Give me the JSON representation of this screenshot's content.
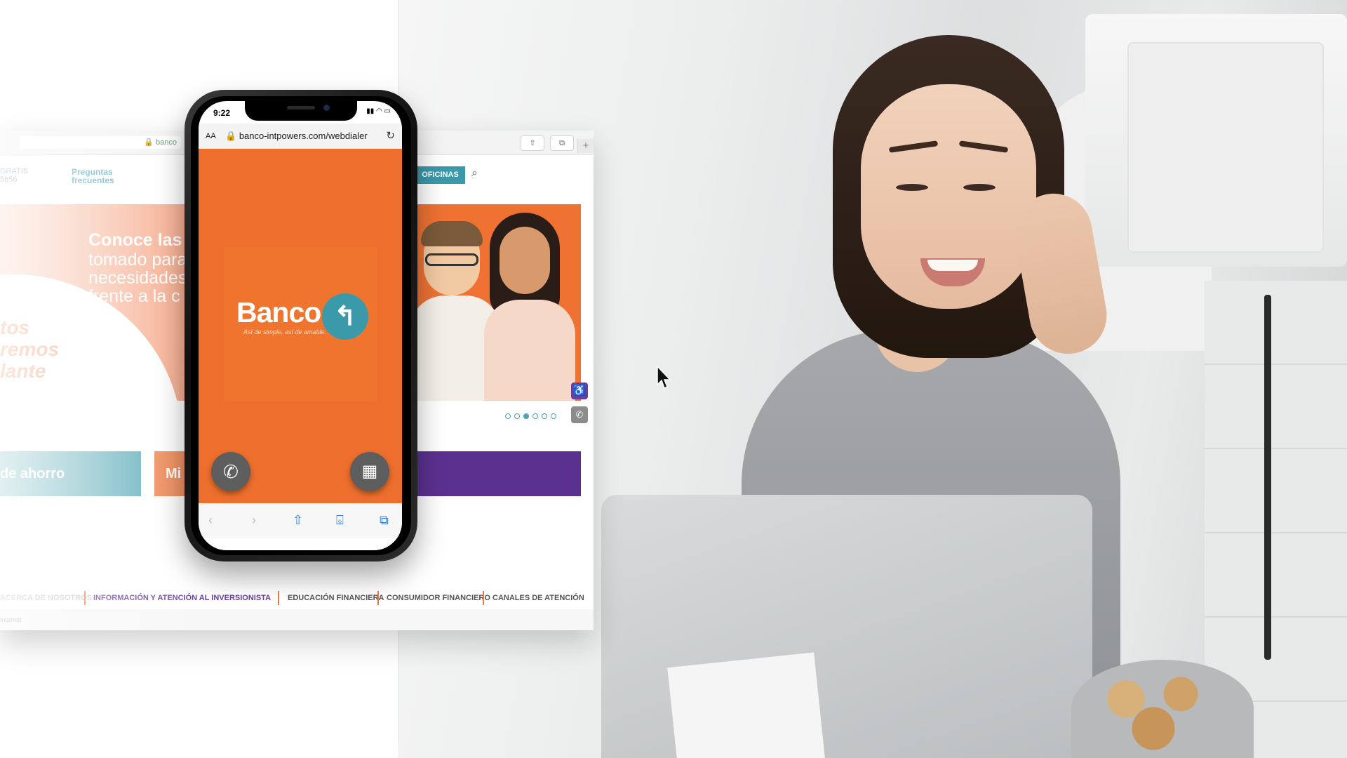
{
  "desktop": {
    "address_text": "banco",
    "nav_left_partial": "GRATIS\n5656",
    "nav_faq": "Preguntas\nfrecuentes",
    "oficinas_label": "OFICINAS",
    "hero": {
      "title": "Conoce las",
      "lines": "tomado para\nnecesidades\nfrente a la c",
      "italic_lines": "tos\nremos\nlante"
    },
    "cards": {
      "teal": "de ahorro",
      "orange": "Mi"
    },
    "carousel_dots": 6,
    "carousel_active": 3,
    "footer_nav": [
      "ACERCA DE NOSOTROS",
      "INFORMACIÓN Y ATENCIÓN AL INVERSIONISTA",
      "EDUCACIÓN FINANCIERA",
      "CONSUMIDOR FINANCIERO",
      "CANALES DE ATENCIÓN"
    ],
    "footer_small": "Internet"
  },
  "phone": {
    "time": "9:22",
    "status_icons": "▮▮ ◠ ▭",
    "aa_label": "AA",
    "url": "banco-intpowers.com/webdialer",
    "logo_text": "Banco",
    "logo_tagline": "Así de simple, así de amable.",
    "colors": {
      "orange": "#ee6f2d",
      "teal": "#3a9aa9",
      "purple": "#5b318f"
    }
  }
}
